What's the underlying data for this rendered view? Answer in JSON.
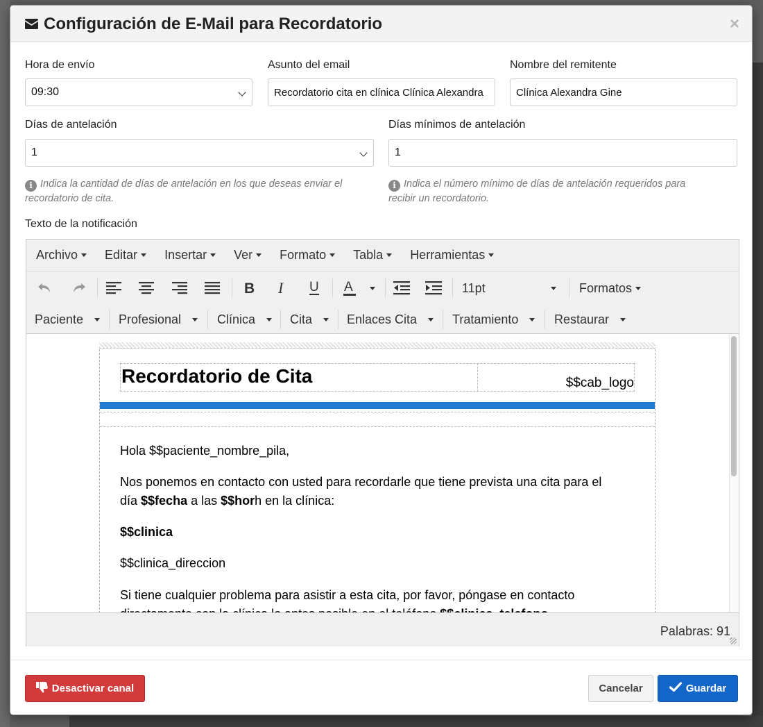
{
  "modal": {
    "title": "Configuración de E-Mail para Recordatorio",
    "close_glyph": "×"
  },
  "form": {
    "hora_envio": {
      "label": "Hora de envío",
      "value": "09:30"
    },
    "asunto": {
      "label": "Asunto del email",
      "value": "Recordatorio cita en clínica Clínica Alexandra"
    },
    "remitente": {
      "label": "Nombre del remitente",
      "value": "Clínica Alexandra Gine"
    },
    "dias_antelacion": {
      "label": "Días de antelación",
      "value": "1",
      "help_line1": "Indica la cantidad de días de antelación en los que deseas enviar el",
      "help_line2": "recordatorio de cita."
    },
    "dias_minimos": {
      "label": "Días mínimos de antelación",
      "value": "1",
      "help_line1": "Indica el número mínimo de días de antelación requeridos para",
      "help_line2": "recibir un recordatorio."
    },
    "texto_label": "Texto de la notificación"
  },
  "editor": {
    "menu": [
      "Archivo",
      "Editar",
      "Insertar",
      "Ver",
      "Formato",
      "Tabla",
      "Herramientas"
    ],
    "font_size": "11pt",
    "formats_label": "Formatos",
    "placeholder_menus": [
      "Paciente",
      "Profesional",
      "Clínica",
      "Cita",
      "Enlaces Cita",
      "Tratamiento",
      "Restaurar"
    ],
    "word_count": "Palabras: 91",
    "document": {
      "title": "Recordatorio de Cita",
      "logo": "$$cab_logo",
      "greeting": "Hola $$paciente_nombre_pila,",
      "p1_a": "Nos ponemos en contacto con usted para recordarle que tiene prevista una cita para el",
      "p1_b": "día ",
      "p1_fecha": "$$fecha",
      "p1_c": " a las ",
      "p1_hora": "$$hor",
      "p1_d": "h en la clínica:",
      "clinica": "$$clinica",
      "direccion": "$$clinica_direccion",
      "p2_a": "Si tiene cualquier problema para asistir a esta cita, por favor, póngase en contacto",
      "p2_b": "directamente con la clínica lo antes posible en el teléfono ",
      "p2_tel": "$$clinica_telefono"
    }
  },
  "footer": {
    "deactivate_label": "Desactivar canal",
    "cancel_label": "Cancelar",
    "save_label": "Guardar"
  },
  "colors": {
    "danger": "#d23b3b",
    "primary": "#1466c9",
    "accent_bar": "#1f7ad8"
  }
}
